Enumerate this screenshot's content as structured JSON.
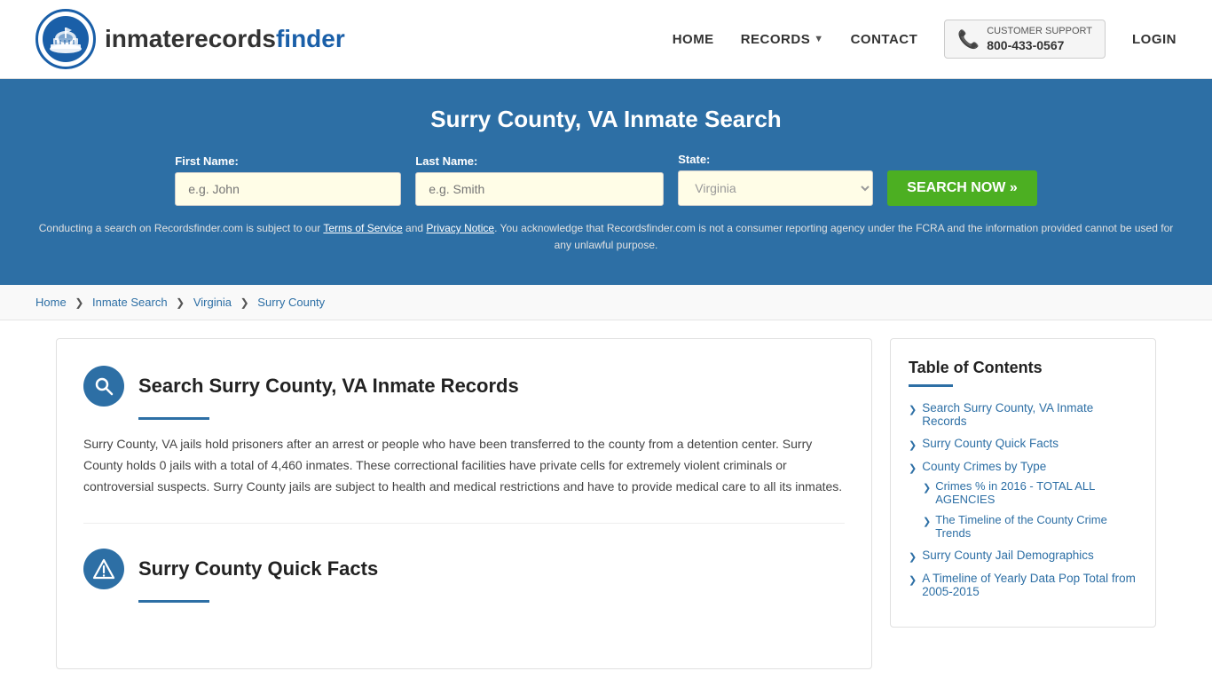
{
  "header": {
    "logo_text_part1": "inmaterecords",
    "logo_text_part2": "finder",
    "nav": {
      "home": "HOME",
      "records": "RECORDS",
      "contact": "CONTACT",
      "login": "LOGIN"
    },
    "support": {
      "label": "CUSTOMER SUPPORT",
      "phone": "800-433-0567"
    }
  },
  "hero": {
    "title": "Surry County, VA Inmate Search",
    "form": {
      "first_name_label": "First Name:",
      "first_name_placeholder": "e.g. John",
      "last_name_label": "Last Name:",
      "last_name_placeholder": "e.g. Smith",
      "state_label": "State:",
      "state_value": "Virginia",
      "search_button": "SEARCH NOW »"
    },
    "disclaimer": "Conducting a search on Recordsfinder.com is subject to our Terms of Service and Privacy Notice. You acknowledge that Recordsfinder.com is not a consumer reporting agency under the FCRA and the information provided cannot be used for any unlawful purpose."
  },
  "breadcrumb": {
    "home": "Home",
    "inmate_search": "Inmate Search",
    "state": "Virginia",
    "county": "Surry County"
  },
  "main": {
    "sections": [
      {
        "id": "inmate-records",
        "icon": "search",
        "title": "Search Surry County, VA Inmate Records",
        "text": "Surry County, VA jails hold prisoners after an arrest or people who have been transferred to the county from a detention center. Surry County holds 0 jails with a total of 4,460 inmates. These correctional facilities have private cells for extremely violent criminals or controversial suspects. Surry County jails are subject to health and medical restrictions and have to provide medical care to all its inmates."
      },
      {
        "id": "quick-facts",
        "icon": "warning",
        "title": "Surry County Quick Facts",
        "text": ""
      }
    ]
  },
  "sidebar": {
    "toc_title": "Table of Contents",
    "items": [
      {
        "label": "Search Surry County, VA Inmate Records",
        "href": "#",
        "sub": []
      },
      {
        "label": "Surry County Quick Facts",
        "href": "#",
        "sub": []
      },
      {
        "label": "County Crimes by Type",
        "href": "#",
        "sub": [
          {
            "label": "Crimes % in 2016 - TOTAL ALL AGENCIES",
            "href": "#"
          },
          {
            "label": "The Timeline of the County Crime Trends",
            "href": "#"
          }
        ]
      },
      {
        "label": "Surry County Jail Demographics",
        "href": "#",
        "sub": []
      },
      {
        "label": "A Timeline of Yearly Data Pop Total from 2005-2015",
        "href": "#",
        "sub": []
      }
    ]
  }
}
